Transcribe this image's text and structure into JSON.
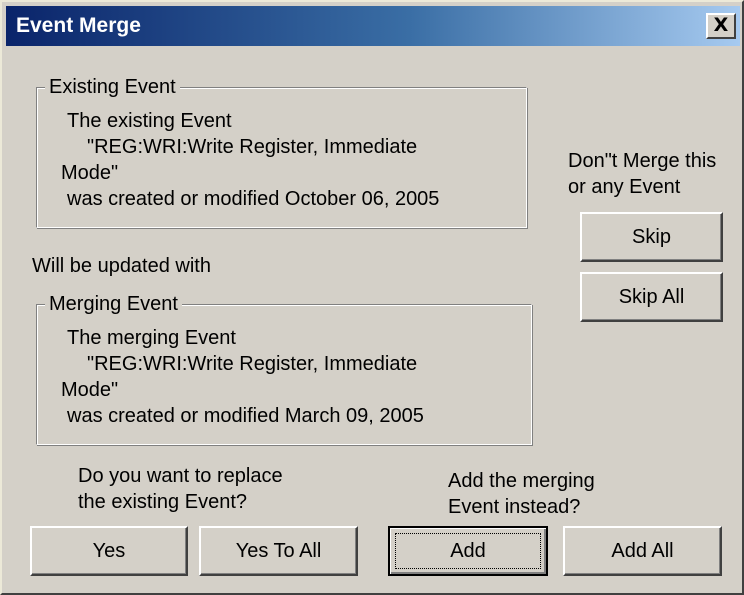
{
  "window": {
    "title": "Event Merge",
    "close_label": "X"
  },
  "existing_event": {
    "legend": "Existing Event",
    "line1": "The existing Event",
    "line2": "\"REG:WRI:Write Register, Immediate",
    "line3": "Mode\"",
    "line4": "was created or modified  October 06, 2005"
  },
  "update_text": "Will be updated with",
  "merging_event": {
    "legend": "Merging Event",
    "line1": "The merging Event",
    "line2": "\"REG:WRI:Write Register, Immediate",
    "line3": "Mode\"",
    "line4": "was created or modified  March 09, 2005"
  },
  "skip_prompt": {
    "line1": "Don\"t Merge this",
    "line2": "or any Event"
  },
  "replace_prompt": {
    "line1": "Do you want to replace",
    "line2": "the existing Event?"
  },
  "add_prompt": {
    "line1": "Add the merging",
    "line2": "Event instead?"
  },
  "buttons": {
    "skip": "Skip",
    "skip_all": "Skip All",
    "yes": "Yes",
    "yes_to_all": "Yes To All",
    "add": "Add",
    "add_all": "Add All"
  }
}
